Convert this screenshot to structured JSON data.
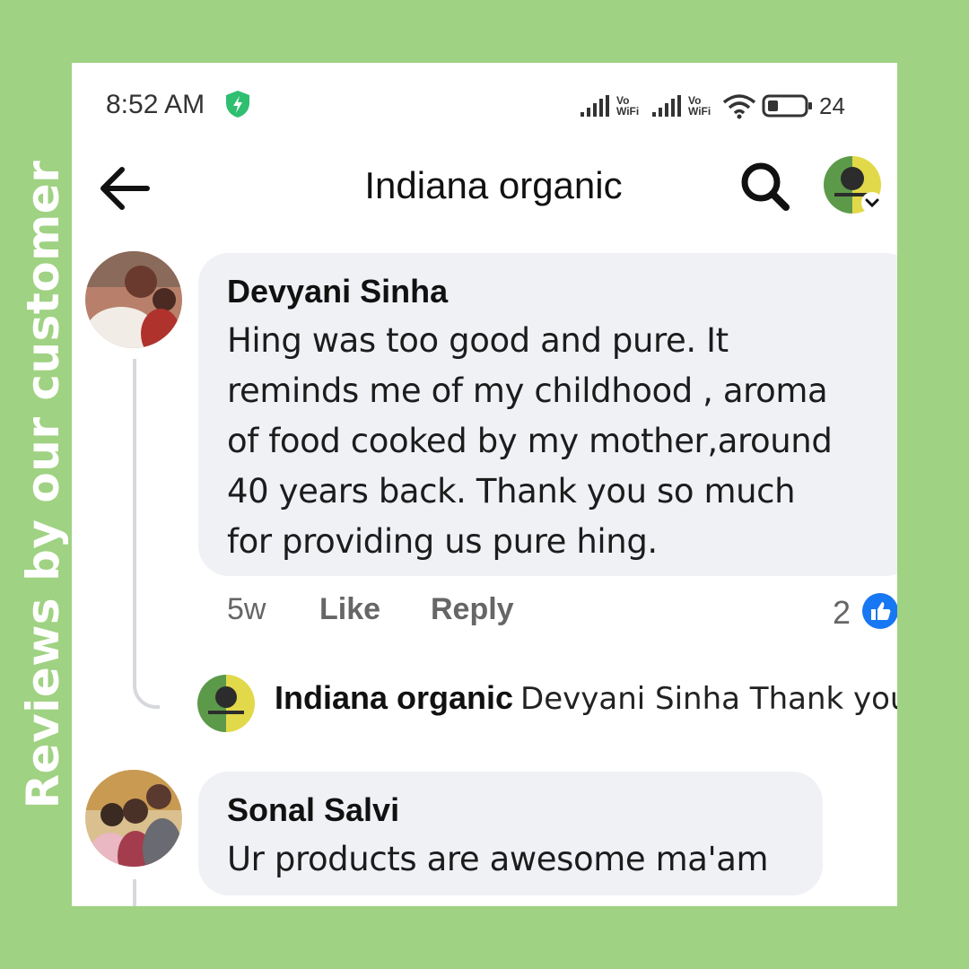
{
  "side_caption": "Reviews by our customer",
  "status_bar": {
    "time": "8:52 AM",
    "vowifi_1": "Vo WiFi",
    "vowifi_2": "Vo WiFi",
    "battery_percent": "24"
  },
  "header": {
    "title": "Indiana organic",
    "icons": [
      "back-arrow-icon",
      "search-icon",
      "chevron-down-icon"
    ]
  },
  "comments": [
    {
      "author": "Devyani Sinha",
      "lines": [
        "Hing was too good and pure. It",
        "reminds me of my childhood , aroma",
        "of food cooked by my mother,around",
        "40 years back. Thank you so much",
        "for providing us pure hing."
      ],
      "time": "5w",
      "like_label": "Like",
      "reply_label": "Reply",
      "reaction_count": "2",
      "reply_preview": {
        "author": "Indiana organic",
        "text": "Devyani Sinha Thank you..."
      }
    },
    {
      "author": "Sonal Salvi",
      "lines": [
        "Ur products are awesome ma'am"
      ]
    }
  ],
  "colors": {
    "frame_green": "#9fd282",
    "bubble_gray": "#eff1f5",
    "like_blue": "#1877f2",
    "shield_green": "#2fbf71"
  }
}
